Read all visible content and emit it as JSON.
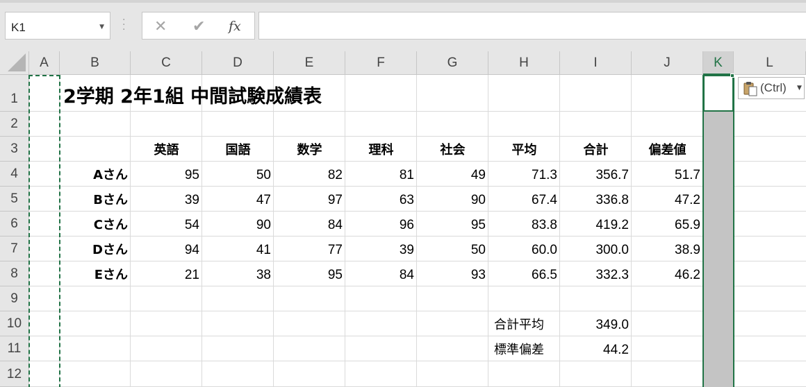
{
  "name_box": {
    "value": "K1"
  },
  "formula_bar": {
    "cancel_glyph": "✕",
    "enter_glyph": "✔",
    "fx_glyph": "fx",
    "value": ""
  },
  "columns": [
    "A",
    "B",
    "C",
    "D",
    "E",
    "F",
    "G",
    "H",
    "I",
    "J",
    "K",
    "L"
  ],
  "selected_column": "K",
  "rows": [
    "1",
    "2",
    "3",
    "4",
    "5",
    "6",
    "7",
    "8",
    "9",
    "10",
    "11",
    "12"
  ],
  "sheet": {
    "title": "2学期 2年1組 中間試験成績表",
    "headers": [
      "英語",
      "国語",
      "数学",
      "理科",
      "社会",
      "平均",
      "合計",
      "偏差値"
    ],
    "students": [
      {
        "name": "Aさん",
        "values": [
          "95",
          "50",
          "82",
          "81",
          "49",
          "71.3",
          "356.7",
          "51.7"
        ]
      },
      {
        "name": "Bさん",
        "values": [
          "39",
          "47",
          "97",
          "63",
          "90",
          "67.4",
          "336.8",
          "47.2"
        ]
      },
      {
        "name": "Cさん",
        "values": [
          "54",
          "90",
          "84",
          "96",
          "95",
          "83.8",
          "419.2",
          "65.9"
        ]
      },
      {
        "name": "Dさん",
        "values": [
          "94",
          "41",
          "77",
          "39",
          "50",
          "60.0",
          "300.0",
          "38.9"
        ]
      },
      {
        "name": "Eさん",
        "values": [
          "21",
          "38",
          "95",
          "84",
          "93",
          "66.5",
          "332.3",
          "46.2"
        ]
      }
    ],
    "summary": [
      {
        "label": "合計平均",
        "value": "349.0"
      },
      {
        "label": "標準偏差",
        "value": "44.2"
      }
    ]
  },
  "paste_options": {
    "label": "(Ctrl)"
  },
  "colors": {
    "accent": "#217346",
    "header_bg": "#e6e6e6",
    "selected_bg": "#c4c4c4"
  }
}
